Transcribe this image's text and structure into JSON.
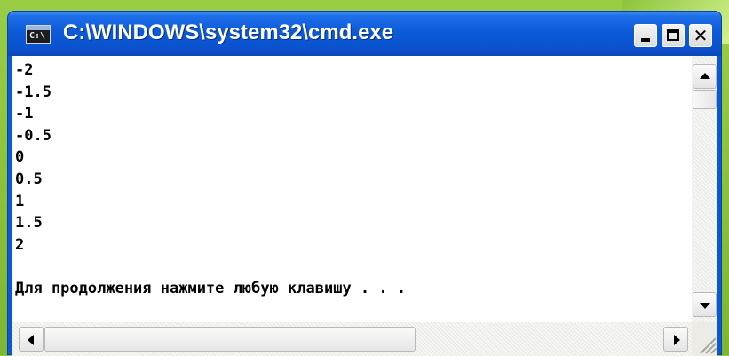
{
  "window": {
    "title": "C:\\WINDOWS\\system32\\cmd.exe",
    "icon_label": "C:\\",
    "icon_name": "cmd-console-icon"
  },
  "title_buttons": {
    "minimize_icon": "minimize-icon",
    "maximize_icon": "maximize-icon",
    "close_icon": "close-icon",
    "close_glyph": "✕"
  },
  "console": {
    "lines": [
      "-2",
      "-1.5",
      "-1",
      "-0.5",
      "0",
      "0.5",
      "1",
      "1.5",
      "2",
      "",
      "Для продолжения нажмите любую клавишу . . ."
    ]
  },
  "colors": {
    "title_bar": "#0b53cf",
    "console_background": "#ffffff",
    "console_text": "#000000",
    "desktop_background": "#8cc43a"
  }
}
